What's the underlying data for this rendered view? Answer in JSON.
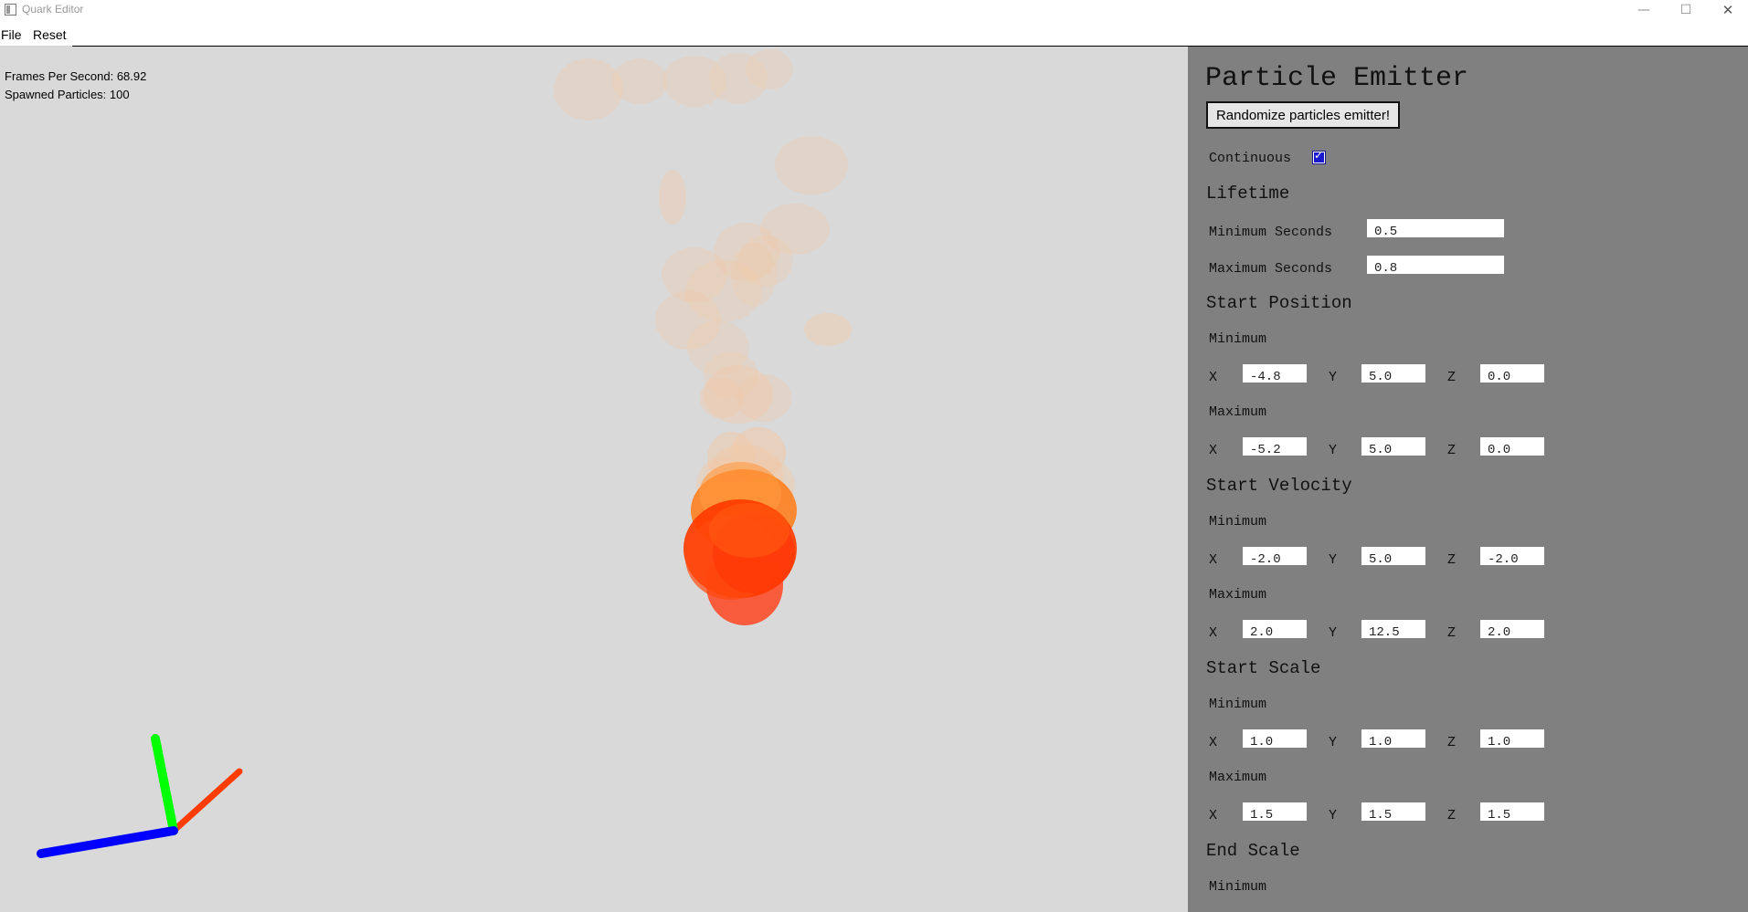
{
  "window": {
    "title": "Quark Editor",
    "minimize_glyph": "—",
    "maximize_glyph": "☐",
    "close_glyph": "✕"
  },
  "menu": {
    "file": "File",
    "reset": "Reset"
  },
  "stats": {
    "fps": "Frames Per Second: 68.92",
    "spawned": "Spawned Particles: 100"
  },
  "colors": {
    "axis_x": "#ff3c00",
    "axis_y": "#00ff00",
    "axis_z": "#0000ff",
    "panel_bg": "#808080",
    "viewport_bg": "#d9d9d9",
    "particle_core": "#ff3c00"
  },
  "panel": {
    "title": "Particle Emitter",
    "randomize_button": "Randomize particles emitter!",
    "continuous_label": "Continuous",
    "continuous_checked": true,
    "lifetime": {
      "heading": "Lifetime",
      "min_label": "Minimum Seconds",
      "min_value": "0.5",
      "max_label": "Maximum Seconds",
      "max_value": "0.8"
    },
    "start_position": {
      "heading": "Start Position",
      "min_label": "Minimum",
      "min": {
        "x": "-4.8",
        "y": "5.0",
        "z": "0.0"
      },
      "max_label": "Maximum",
      "max": {
        "x": "-5.2",
        "y": "5.0",
        "z": "0.0"
      }
    },
    "start_velocity": {
      "heading": "Start Velocity",
      "min_label": "Minimum",
      "min": {
        "x": "-2.0",
        "y": "5.0",
        "z": "-2.0"
      },
      "max_label": "Maximum",
      "max": {
        "x": "2.0",
        "y": "12.5",
        "z": "2.0"
      }
    },
    "start_scale": {
      "heading": "Start Scale",
      "min_label": "Minimum",
      "min": {
        "x": "1.0",
        "y": "1.0",
        "z": "1.0"
      },
      "max_label": "Maximum",
      "max": {
        "x": "1.5",
        "y": "1.5",
        "z": "1.5"
      }
    },
    "end_scale": {
      "heading": "End Scale",
      "min_label": "Minimum"
    },
    "axis_labels": {
      "x": "X",
      "y": "Y",
      "z": "Z"
    }
  }
}
